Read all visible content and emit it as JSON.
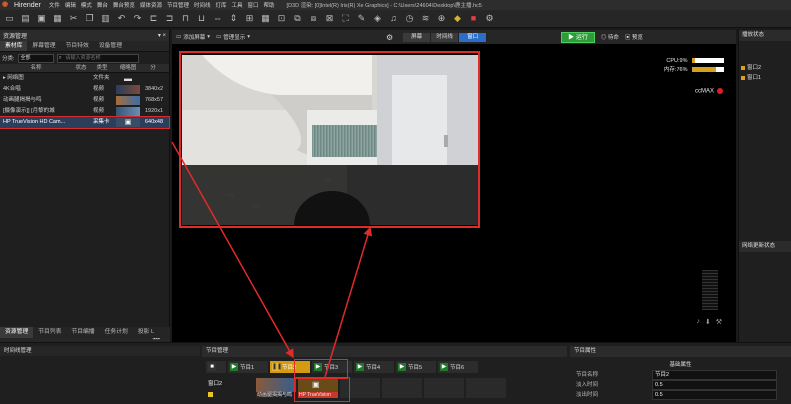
{
  "app": {
    "name": "Hirender",
    "menus": [
      "文件",
      "编辑",
      "模式",
      "舞台",
      "舞台预览",
      "媒体资源",
      "节目管理",
      "时间线",
      "灯库",
      "工具",
      "窗口",
      "帮助"
    ],
    "title": "[D3D 渲染: [0]Intel(R) Iris(R) Xe Graphics] - C:\\Users\\24604\\Desktop\\鹿主播.hc5"
  },
  "resource_panel": {
    "title": "资源管理",
    "tabs": [
      "素材库",
      "屏幕管理",
      "节目特效",
      "设备管理"
    ],
    "filter_label": "分类:",
    "filter_value": "全部",
    "search_placeholder": "请输入资源名称",
    "columns": [
      "名称",
      "状态",
      "类型",
      "缩略图",
      "分"
    ],
    "rows": [
      {
        "name": "网络图",
        "type": "文件夹",
        "res": ""
      },
      {
        "name": "4K合唱",
        "type": "视频",
        "res": "3840x2"
      },
      {
        "name": "动画腿揭揭与鸣",
        "type": "视频",
        "res": "768x57"
      },
      {
        "name": "[摄像演示]] [月黎的城",
        "type": "视频",
        "res": "1920x1"
      },
      {
        "name": "HP TrueVision HD Cam...",
        "type": "采集卡",
        "res": "640x48"
      }
    ],
    "bottom_tabs": [
      "资源管理",
      "节目列表",
      "节目编播",
      "任务计划",
      "投影 L"
    ]
  },
  "stage": {
    "add_screen": "添加屏幕",
    "manage_display": "管理显示",
    "modes": [
      "屏幕",
      "时间线",
      "窗口"
    ],
    "active_mode": "窗口",
    "run_label": "运行",
    "wait_label": "待命",
    "preview_label": "预览",
    "cpu_label": "CPU:9%",
    "cpu_value": 9,
    "mem_label": "内存:76%",
    "mem_value": 76,
    "ccmax_label": "ccMAX"
  },
  "right_panel": {
    "title": "播放状态",
    "items": [
      "窗口2",
      "窗口1"
    ],
    "net_title": "网络更新状态"
  },
  "timeline_panel": {
    "title": "时间线管理"
  },
  "program_panel": {
    "title": "节目管理",
    "tabs": [
      "节目1",
      "节目2",
      "节目3",
      "节目4",
      "节目5",
      "节目6"
    ],
    "selected_tab": "节目2",
    "row_label": "窗口2",
    "cells": [
      "动画腿揭揭与鸣",
      "HP TrueVision"
    ]
  },
  "props_panel": {
    "title": "节目属性",
    "section": "基础属性",
    "fields": [
      {
        "key": "节目名称",
        "value": "节目2"
      },
      {
        "key": "淡入时间",
        "value": "0.5"
      },
      {
        "key": "淡出时间",
        "value": "0.5"
      }
    ]
  }
}
